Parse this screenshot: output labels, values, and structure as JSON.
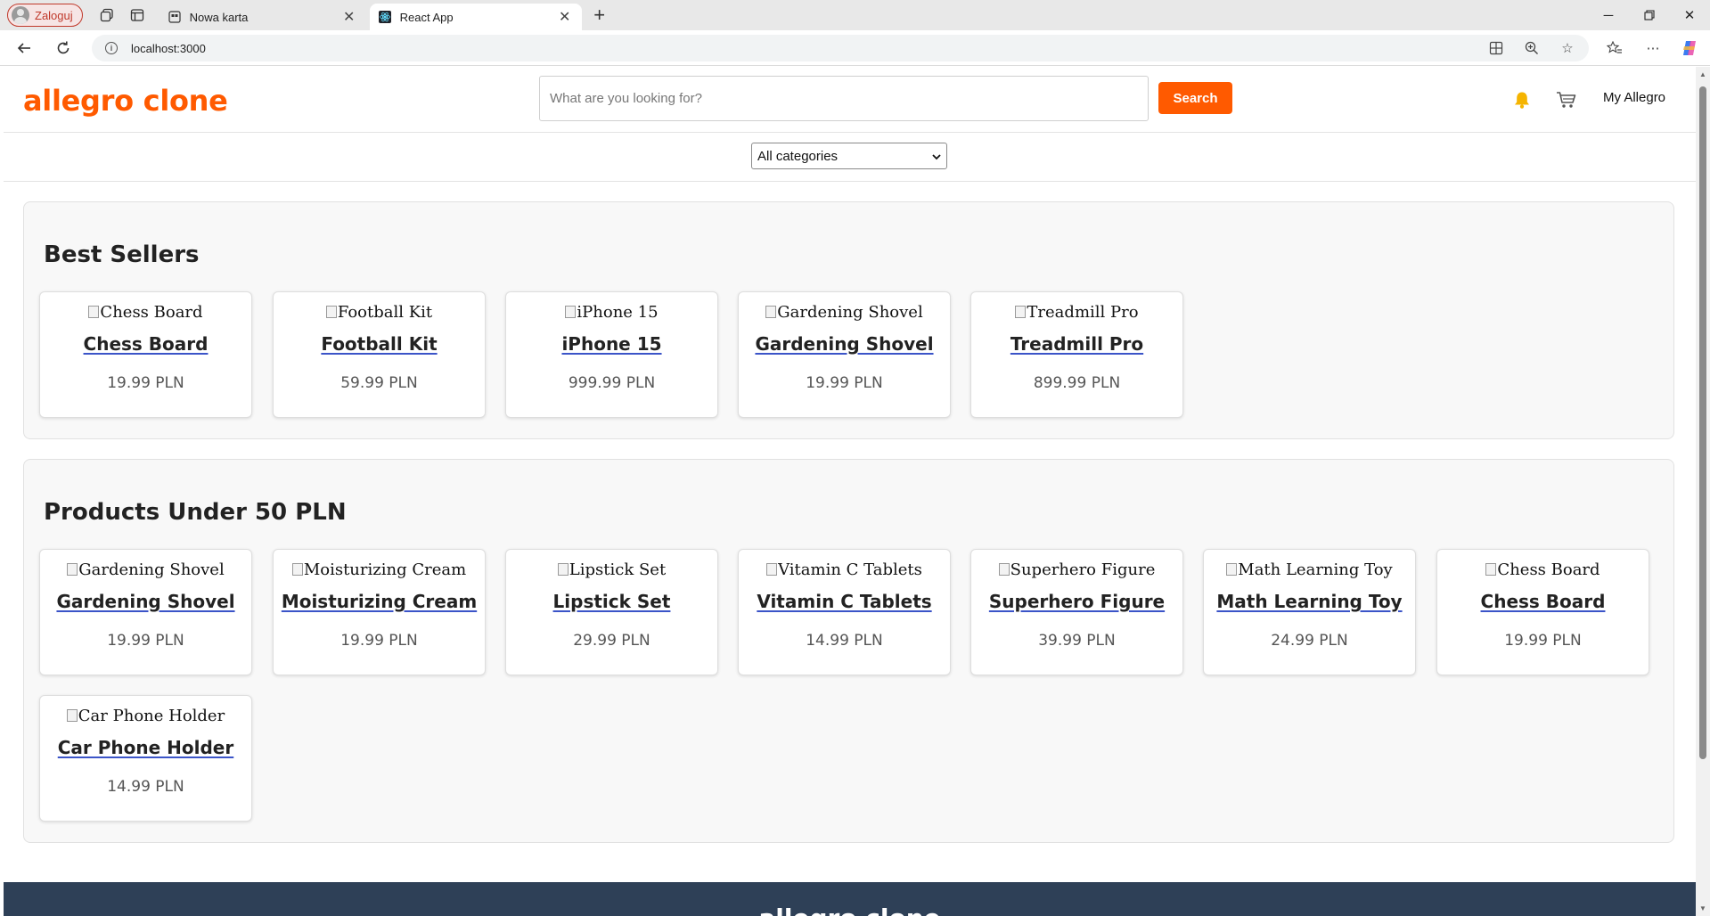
{
  "browser": {
    "profile_label": "Zaloguj",
    "tabs": [
      {
        "title": "Nowa karta",
        "active": false
      },
      {
        "title": "React App",
        "active": true
      }
    ],
    "url": "localhost:3000"
  },
  "header": {
    "logo": "allegro clone",
    "search_placeholder": "What are you looking for?",
    "search_button": "Search",
    "account_label": "My Allegro"
  },
  "category_filter": {
    "selected": "All categories"
  },
  "sections": [
    {
      "title": "Best Sellers",
      "products": [
        {
          "image_alt": "Chess Board",
          "name": "Chess Board",
          "price": "19.99 PLN"
        },
        {
          "image_alt": "Football Kit",
          "name": "Football Kit",
          "price": "59.99 PLN"
        },
        {
          "image_alt": "iPhone 15",
          "name": "iPhone 15",
          "price": "999.99 PLN"
        },
        {
          "image_alt": "Gardening Shovel",
          "name": "Gardening Shovel",
          "price": "19.99 PLN"
        },
        {
          "image_alt": "Treadmill Pro",
          "name": "Treadmill Pro",
          "price": "899.99 PLN"
        }
      ]
    },
    {
      "title": "Products Under 50 PLN",
      "products": [
        {
          "image_alt": "Gardening Shovel",
          "name": "Gardening Shovel",
          "price": "19.99 PLN"
        },
        {
          "image_alt": "Moisturizing Cream",
          "name": "Moisturizing Cream",
          "price": "19.99 PLN"
        },
        {
          "image_alt": "Lipstick Set",
          "name": "Lipstick Set",
          "price": "29.99 PLN"
        },
        {
          "image_alt": "Vitamin C Tablets",
          "name": "Vitamin C Tablets",
          "price": "14.99 PLN"
        },
        {
          "image_alt": "Superhero Figure",
          "name": "Superhero Figure",
          "price": "39.99 PLN"
        },
        {
          "image_alt": "Math Learning Toy",
          "name": "Math Learning Toy",
          "price": "24.99 PLN"
        },
        {
          "image_alt": "Chess Board",
          "name": "Chess Board",
          "price": "19.99 PLN"
        },
        {
          "image_alt": "Car Phone Holder",
          "name": "Car Phone Holder",
          "price": "14.99 PLN"
        }
      ]
    }
  ],
  "footer": {
    "title": "allegro clone"
  },
  "colors": {
    "brand": "#ff5a00",
    "footer": "#2e4057",
    "bell": "#f5b400"
  },
  "icons": [
    "bell-icon",
    "cart-icon",
    "search-icon"
  ]
}
